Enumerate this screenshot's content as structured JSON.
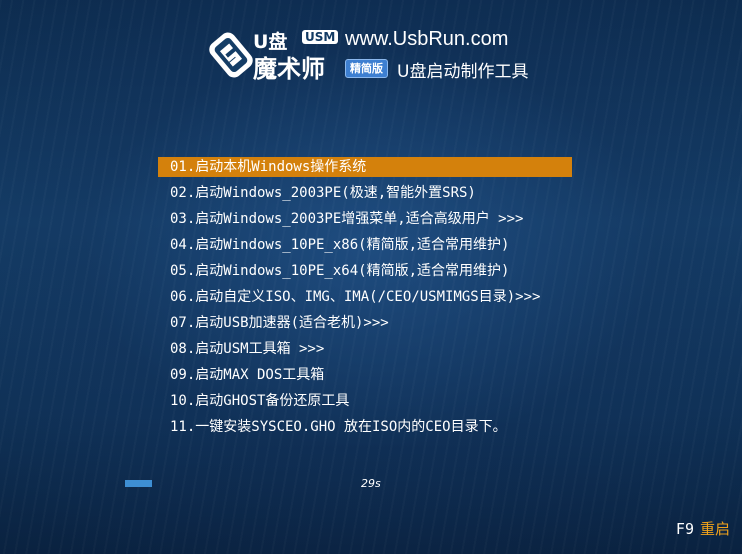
{
  "header": {
    "logo_u": "U盘",
    "logo_badge": "USM",
    "logo_name": "魔术师",
    "site_url": "www.UsbRun.com",
    "edition_badge": "精简版",
    "tagline": "U盘启动制作工具"
  },
  "menu": {
    "selected_index": 0,
    "items": [
      {
        "label": "01.启动本机Windows操作系统"
      },
      {
        "label": "02.启动Windows_2003PE(极速,智能外置SRS)"
      },
      {
        "label": "03.启动Windows_2003PE增强菜单,适合高级用户 >>>"
      },
      {
        "label": "04.启动Windows_10PE_x86(精简版,适合常用维护)"
      },
      {
        "label": "05.启动Windows_10PE_x64(精简版,适合常用维护)"
      },
      {
        "label": "06.启动自定义ISO、IMG、IMA(/CEO/USMIMGS目录)>>>"
      },
      {
        "label": "07.启动USB加速器(适合老机)>>>"
      },
      {
        "label": "08.启动USM工具箱 >>>"
      },
      {
        "label": "09.启动MAX DOS工具箱"
      },
      {
        "label": "10.启动GHOST备份还原工具"
      },
      {
        "label": "11.一键安装SYSCEO.GHO 放在ISO内的CEO目录下。"
      }
    ]
  },
  "countdown": {
    "text": "29s",
    "progress_fraction": 0.055
  },
  "footer": {
    "key": "F9",
    "label": "重启"
  },
  "colors": {
    "selection": "#d4810c",
    "progress": "#3e8fd4",
    "reboot_label": "#f0a21b",
    "background": "#143d66"
  }
}
